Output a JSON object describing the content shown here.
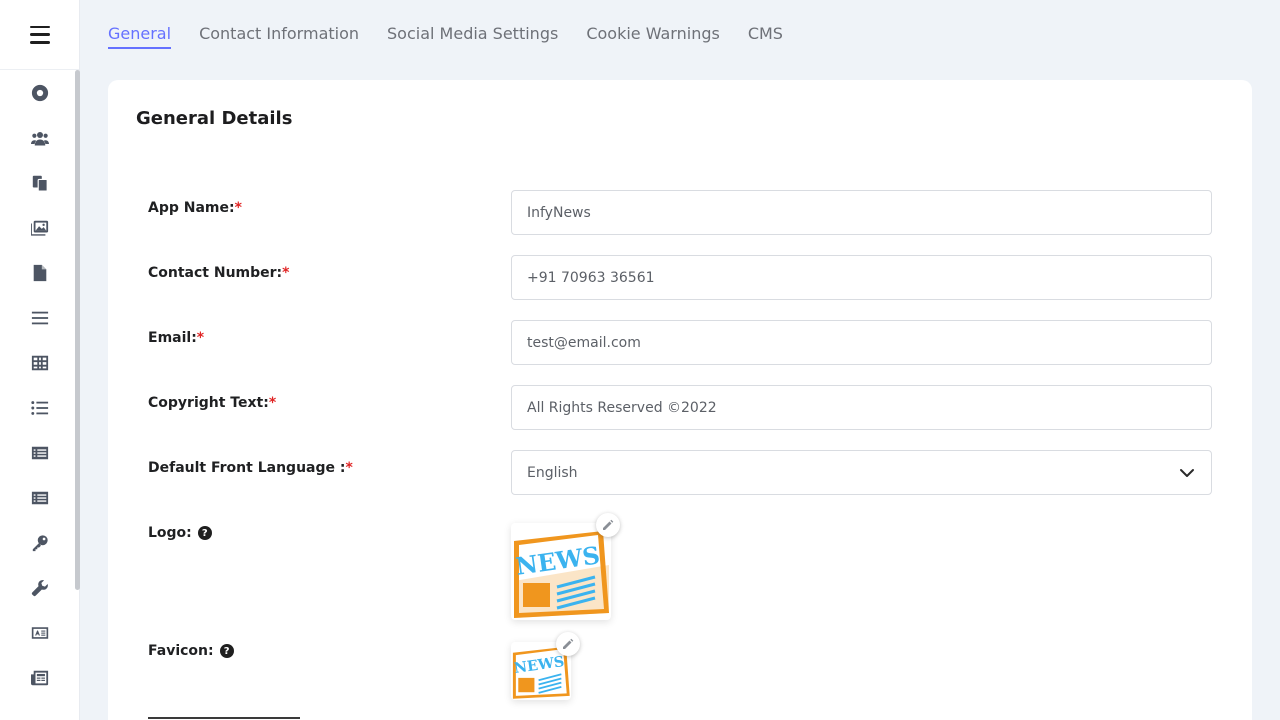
{
  "sidebar": {
    "icons": [
      "dashboard-icon",
      "users-icon",
      "copy-icon",
      "images-icon",
      "file-icon",
      "menu-icon",
      "table-icon",
      "list-icon",
      "list-alt-icon",
      "list-alt-icon-2",
      "key-icon",
      "wrench-icon",
      "id-card-icon",
      "newspaper-icon"
    ]
  },
  "tabs": [
    {
      "label": "General",
      "active": true
    },
    {
      "label": "Contact Information",
      "active": false
    },
    {
      "label": "Social Media Settings",
      "active": false
    },
    {
      "label": "Cookie Warnings",
      "active": false
    },
    {
      "label": "CMS",
      "active": false
    }
  ],
  "card": {
    "title": "General Details",
    "fields": {
      "app_name": {
        "label": "App Name:",
        "required": "*",
        "value": "InfyNews"
      },
      "contact_number": {
        "label": "Contact Number:",
        "required": "*",
        "value": "+91 70963 36561"
      },
      "email": {
        "label": "Email:",
        "required": "*",
        "value": "test@email.com"
      },
      "copyright": {
        "label": "Copyright Text:",
        "required": "*",
        "value": "All Rights Reserved ©2022"
      },
      "language": {
        "label": "Default Front Language :",
        "required": "*",
        "value": "English"
      },
      "logo": {
        "label": "Logo:",
        "help": "?",
        "image_text": "NEWS"
      },
      "favicon": {
        "label": "Favicon:",
        "help": "?",
        "image_text": "NEWS"
      }
    }
  },
  "colors": {
    "accent": "#6571ff",
    "required": "#e02424",
    "logo_orange": "#f0961e",
    "logo_blue": "#3bb3ef"
  }
}
